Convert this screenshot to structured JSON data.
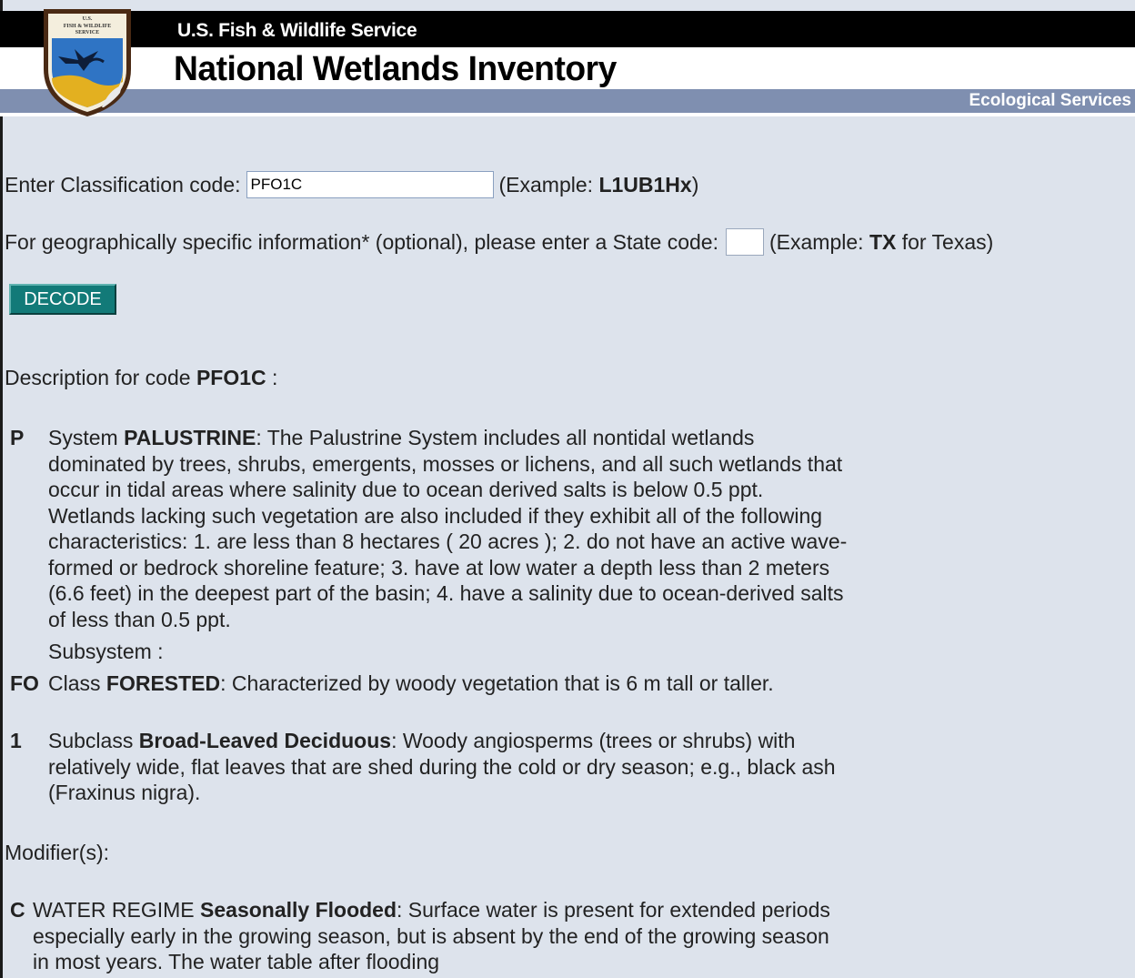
{
  "header": {
    "logo_text": "U.S. FISH & WILDLIFE SERVICE",
    "agency": "U.S. Fish & Wildlife Service",
    "program": "National Wetlands Inventory",
    "section": "Ecological Services"
  },
  "form": {
    "code_label": "Enter Classification code:",
    "code_value": "PFO1C",
    "code_example_prefix": "(Example:",
    "code_example": "L1UB1Hx",
    "code_example_suffix": ")",
    "state_label": "For geographically specific information* (optional), please enter a State code:",
    "state_value": "",
    "state_example_prefix": "(Example:",
    "state_example": "TX",
    "state_example_suffix": "for Texas)",
    "decode_label": "DECODE"
  },
  "description": {
    "prefix": "Description for code",
    "code": "PFO1C",
    "suffix": ":",
    "system": {
      "code": "P",
      "prefix": "System",
      "name": "PALUSTRINE",
      "text": ": The Palustrine System includes all nontidal wetlands dominated by trees, shrubs, emergents, mosses or lichens, and all such wetlands that occur in tidal areas where salinity due to ocean derived salts is below 0.5 ppt. Wetlands lacking such vegetation are also included if they exhibit all of the following characteristics: 1. are less than 8 hectares ( 20 acres ); 2. do not have an active wave-formed or bedrock shoreline feature; 3. have at low water a depth less than 2 meters (6.6 feet) in the deepest part of the basin; 4. have a salinity due to ocean-derived salts of less than 0.5 ppt."
    },
    "subsystem_label": "Subsystem :",
    "class": {
      "code": "FO",
      "prefix": "Class",
      "name": "FORESTED",
      "text": ": Characterized by woody vegetation that is 6 m tall or taller."
    },
    "subclass": {
      "code": "1",
      "prefix": "Subclass",
      "name": "Broad-Leaved Deciduous",
      "text": ": Woody angiosperms (trees or shrubs) with relatively wide, flat leaves that are shed during the cold or dry season; e.g., black ash (Fraxinus nigra)."
    },
    "modifiers_label": "Modifier(s):",
    "modifier": {
      "code": "C",
      "prefix": "WATER REGIME",
      "name": "Seasonally Flooded",
      "text": ": Surface water is present for extended periods especially early in the growing season, but is absent by the end of the growing season in most years. The water table after flooding"
    }
  }
}
